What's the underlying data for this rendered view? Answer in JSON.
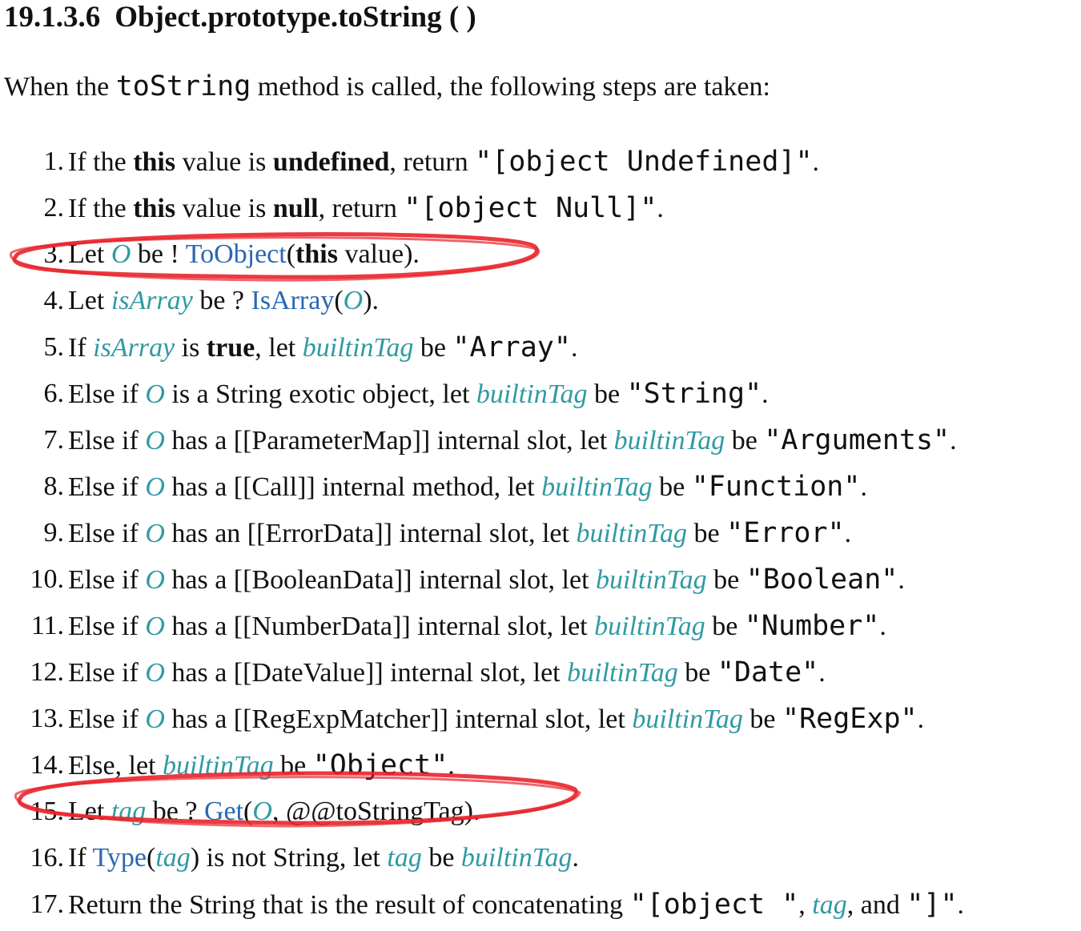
{
  "heading": {
    "number": "19.1.3.6",
    "title": "Object.prototype.toString ( )"
  },
  "intro": [
    {
      "t": "text",
      "v": "When the "
    },
    {
      "t": "code",
      "v": "toString"
    },
    {
      "t": "text",
      "v": " method is called, the following steps are taken:"
    }
  ],
  "colors": {
    "variable": "#2f9aa3",
    "link": "#2a67b1",
    "annotation": "#e8242b"
  },
  "steps": [
    {
      "num": "1.",
      "parts": [
        {
          "t": "text",
          "v": "If the "
        },
        {
          "t": "kw",
          "v": "this"
        },
        {
          "t": "text",
          "v": " value is "
        },
        {
          "t": "kw",
          "v": "undefined"
        },
        {
          "t": "text",
          "v": ", return "
        },
        {
          "t": "code",
          "v": "\"[object Undefined]\""
        },
        {
          "t": "text",
          "v": "."
        }
      ]
    },
    {
      "num": "2.",
      "parts": [
        {
          "t": "text",
          "v": "If the "
        },
        {
          "t": "kw",
          "v": "this"
        },
        {
          "t": "text",
          "v": " value is "
        },
        {
          "t": "kw",
          "v": "null"
        },
        {
          "t": "text",
          "v": ", return "
        },
        {
          "t": "code",
          "v": "\"[object Null]\""
        },
        {
          "t": "text",
          "v": "."
        }
      ]
    },
    {
      "num": "3.",
      "highlighted": true,
      "parts": [
        {
          "t": "text",
          "v": "Let "
        },
        {
          "t": "var",
          "v": "O"
        },
        {
          "t": "text",
          "v": " be ! "
        },
        {
          "t": "fn",
          "v": "ToObject"
        },
        {
          "t": "text",
          "v": "("
        },
        {
          "t": "kw",
          "v": "this"
        },
        {
          "t": "text",
          "v": " value)."
        }
      ]
    },
    {
      "num": "4.",
      "parts": [
        {
          "t": "text",
          "v": "Let "
        },
        {
          "t": "var",
          "v": "isArray"
        },
        {
          "t": "text",
          "v": " be ? "
        },
        {
          "t": "fn",
          "v": "IsArray"
        },
        {
          "t": "text",
          "v": "("
        },
        {
          "t": "var",
          "v": "O"
        },
        {
          "t": "text",
          "v": ")."
        }
      ]
    },
    {
      "num": "5.",
      "parts": [
        {
          "t": "text",
          "v": "If "
        },
        {
          "t": "var",
          "v": "isArray"
        },
        {
          "t": "text",
          "v": " is "
        },
        {
          "t": "kw",
          "v": "true"
        },
        {
          "t": "text",
          "v": ", let "
        },
        {
          "t": "var",
          "v": "builtinTag"
        },
        {
          "t": "text",
          "v": " be "
        },
        {
          "t": "code",
          "v": "\"Array\""
        },
        {
          "t": "text",
          "v": "."
        }
      ]
    },
    {
      "num": "6.",
      "parts": [
        {
          "t": "text",
          "v": "Else if "
        },
        {
          "t": "var",
          "v": "O"
        },
        {
          "t": "text",
          "v": " is a String exotic object, let "
        },
        {
          "t": "var",
          "v": "builtinTag"
        },
        {
          "t": "text",
          "v": " be "
        },
        {
          "t": "code",
          "v": "\"String\""
        },
        {
          "t": "text",
          "v": "."
        }
      ]
    },
    {
      "num": "7.",
      "parts": [
        {
          "t": "text",
          "v": "Else if "
        },
        {
          "t": "var",
          "v": "O"
        },
        {
          "t": "text",
          "v": " has a [[ParameterMap]] internal slot, let "
        },
        {
          "t": "var",
          "v": "builtinTag"
        },
        {
          "t": "text",
          "v": " be "
        },
        {
          "t": "code",
          "v": "\"Arguments\""
        },
        {
          "t": "text",
          "v": "."
        }
      ]
    },
    {
      "num": "8.",
      "parts": [
        {
          "t": "text",
          "v": "Else if "
        },
        {
          "t": "var",
          "v": "O"
        },
        {
          "t": "text",
          "v": " has a [[Call]] internal method, let "
        },
        {
          "t": "var",
          "v": "builtinTag"
        },
        {
          "t": "text",
          "v": " be "
        },
        {
          "t": "code",
          "v": "\"Function\""
        },
        {
          "t": "text",
          "v": "."
        }
      ]
    },
    {
      "num": "9.",
      "parts": [
        {
          "t": "text",
          "v": "Else if "
        },
        {
          "t": "var",
          "v": "O"
        },
        {
          "t": "text",
          "v": " has an [[ErrorData]] internal slot, let "
        },
        {
          "t": "var",
          "v": "builtinTag"
        },
        {
          "t": "text",
          "v": " be "
        },
        {
          "t": "code",
          "v": "\"Error\""
        },
        {
          "t": "text",
          "v": "."
        }
      ]
    },
    {
      "num": "10.",
      "parts": [
        {
          "t": "text",
          "v": "Else if "
        },
        {
          "t": "var",
          "v": "O"
        },
        {
          "t": "text",
          "v": " has a [[BooleanData]] internal slot, let "
        },
        {
          "t": "var",
          "v": "builtinTag"
        },
        {
          "t": "text",
          "v": " be "
        },
        {
          "t": "code",
          "v": "\"Boolean\""
        },
        {
          "t": "text",
          "v": "."
        }
      ]
    },
    {
      "num": "11.",
      "parts": [
        {
          "t": "text",
          "v": "Else if "
        },
        {
          "t": "var",
          "v": "O"
        },
        {
          "t": "text",
          "v": " has a [[NumberData]] internal slot, let "
        },
        {
          "t": "var",
          "v": "builtinTag"
        },
        {
          "t": "text",
          "v": " be "
        },
        {
          "t": "code",
          "v": "\"Number\""
        },
        {
          "t": "text",
          "v": "."
        }
      ]
    },
    {
      "num": "12.",
      "parts": [
        {
          "t": "text",
          "v": "Else if "
        },
        {
          "t": "var",
          "v": "O"
        },
        {
          "t": "text",
          "v": " has a [[DateValue]] internal slot, let "
        },
        {
          "t": "var",
          "v": "builtinTag"
        },
        {
          "t": "text",
          "v": " be "
        },
        {
          "t": "code",
          "v": "\"Date\""
        },
        {
          "t": "text",
          "v": "."
        }
      ]
    },
    {
      "num": "13.",
      "parts": [
        {
          "t": "text",
          "v": "Else if "
        },
        {
          "t": "var",
          "v": "O"
        },
        {
          "t": "text",
          "v": " has a [[RegExpMatcher]] internal slot, let "
        },
        {
          "t": "var",
          "v": "builtinTag"
        },
        {
          "t": "text",
          "v": " be "
        },
        {
          "t": "code",
          "v": "\"RegExp\""
        },
        {
          "t": "text",
          "v": "."
        }
      ]
    },
    {
      "num": "14.",
      "parts": [
        {
          "t": "text",
          "v": "Else, let "
        },
        {
          "t": "var",
          "v": "builtinTag"
        },
        {
          "t": "text",
          "v": " be "
        },
        {
          "t": "code",
          "v": "\"Object\""
        },
        {
          "t": "text",
          "v": "."
        }
      ]
    },
    {
      "num": "15.",
      "highlighted": true,
      "parts": [
        {
          "t": "text",
          "v": "Let "
        },
        {
          "t": "var",
          "v": "tag"
        },
        {
          "t": "text",
          "v": " be ? "
        },
        {
          "t": "fn",
          "v": "Get"
        },
        {
          "t": "text",
          "v": "("
        },
        {
          "t": "var",
          "v": "O"
        },
        {
          "t": "text",
          "v": ", @@toStringTag)."
        }
      ]
    },
    {
      "num": "16.",
      "parts": [
        {
          "t": "text",
          "v": "If "
        },
        {
          "t": "fn",
          "v": "Type"
        },
        {
          "t": "text",
          "v": "("
        },
        {
          "t": "var",
          "v": "tag"
        },
        {
          "t": "text",
          "v": ") is not String, let "
        },
        {
          "t": "var",
          "v": "tag"
        },
        {
          "t": "text",
          "v": " be "
        },
        {
          "t": "var",
          "v": "builtinTag"
        },
        {
          "t": "text",
          "v": "."
        }
      ]
    },
    {
      "num": "17.",
      "parts": [
        {
          "t": "text",
          "v": "Return the String that is the result of concatenating "
        },
        {
          "t": "code",
          "v": "\"[object \""
        },
        {
          "t": "text",
          "v": ", "
        },
        {
          "t": "var",
          "v": "tag"
        },
        {
          "t": "text",
          "v": ", and "
        },
        {
          "t": "code",
          "v": "\"]\""
        },
        {
          "t": "text",
          "v": "."
        }
      ]
    }
  ]
}
